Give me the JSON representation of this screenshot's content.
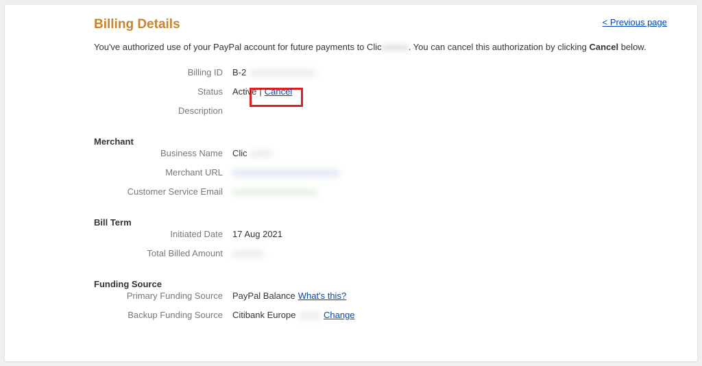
{
  "header": {
    "title": "Billing Details",
    "prev_link": "< Previous page"
  },
  "intro": {
    "part1": "You've authorized use of your PayPal account for future payments to Clic",
    "redacted1": "xxxxxx",
    "part2": ". You can cancel this authorization by clicking ",
    "bold": "Cancel",
    "part3": " below."
  },
  "details": {
    "billing_id_label": "Billing ID",
    "billing_id_prefix": "B-2",
    "billing_id_redacted": "xxxxxxxxxxxxxxx",
    "status_label": "Status",
    "status_value": "Active",
    "status_sep": " | ",
    "status_cancel": "Cancel",
    "description_label": "Description"
  },
  "merchant": {
    "title": "Merchant",
    "business_name_label": "Business Name",
    "business_name_prefix": "Clic",
    "business_name_redacted": "xxxxx",
    "merchant_url_label": "Merchant URL",
    "merchant_url_redacted": "xxxxxxxxxxxxxxxxxxxxxxxx",
    "customer_email_label": "Customer Service Email",
    "customer_email_redacted": "xxxxxxxxxxxxxxxxxxx"
  },
  "bill_term": {
    "title": "Bill Term",
    "initiated_label": "Initiated Date",
    "initiated_value": "17 Aug 2021",
    "total_label": "Total Billed Amount",
    "total_redacted": "xxxxxxx"
  },
  "funding": {
    "title": "Funding Source",
    "primary_label": "Primary Funding Source",
    "primary_value": "PayPal Balance",
    "primary_link": "What's this?",
    "backup_label": "Backup Funding Source",
    "backup_value": "Citibank Europe",
    "backup_redacted": "xxxxx",
    "backup_link": "Change"
  }
}
